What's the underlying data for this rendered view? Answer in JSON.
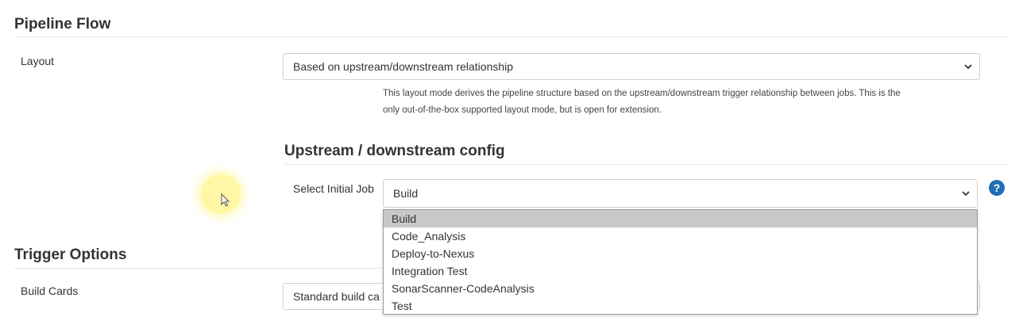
{
  "pipeline_flow": {
    "title": "Pipeline Flow",
    "layout_label": "Layout",
    "layout_value": "Based on upstream/downstream relationship",
    "layout_help_line1": "This layout mode derives the pipeline structure based on the upstream/downstream trigger relationship between jobs. This is the",
    "layout_help_line2": "only out-of-the-box supported layout mode, but is open for extension."
  },
  "upstream_config": {
    "title": "Upstream / downstream config",
    "initial_job_label": "Select Initial Job",
    "initial_job_value": "Build",
    "help_icon_glyph": "?",
    "options": [
      "Build",
      "Code_Analysis",
      "Deploy-to-Nexus",
      "Integration Test",
      "SonarScanner-CodeAnalysis",
      "Test"
    ],
    "highlighted_option": "Build"
  },
  "trigger_options": {
    "title": "Trigger Options",
    "build_cards_label": "Build Cards",
    "build_cards_value": "Standard build ca"
  },
  "colors": {
    "help_icon": "#1f6fb5",
    "highlighted_option_bg": "#c8c8c8",
    "cursor_highlight": "#fff05a"
  },
  "icons": {
    "select_chevron": "chevron-down-icon",
    "help": "help-icon",
    "cursor": "mouse-pointer-icon"
  }
}
